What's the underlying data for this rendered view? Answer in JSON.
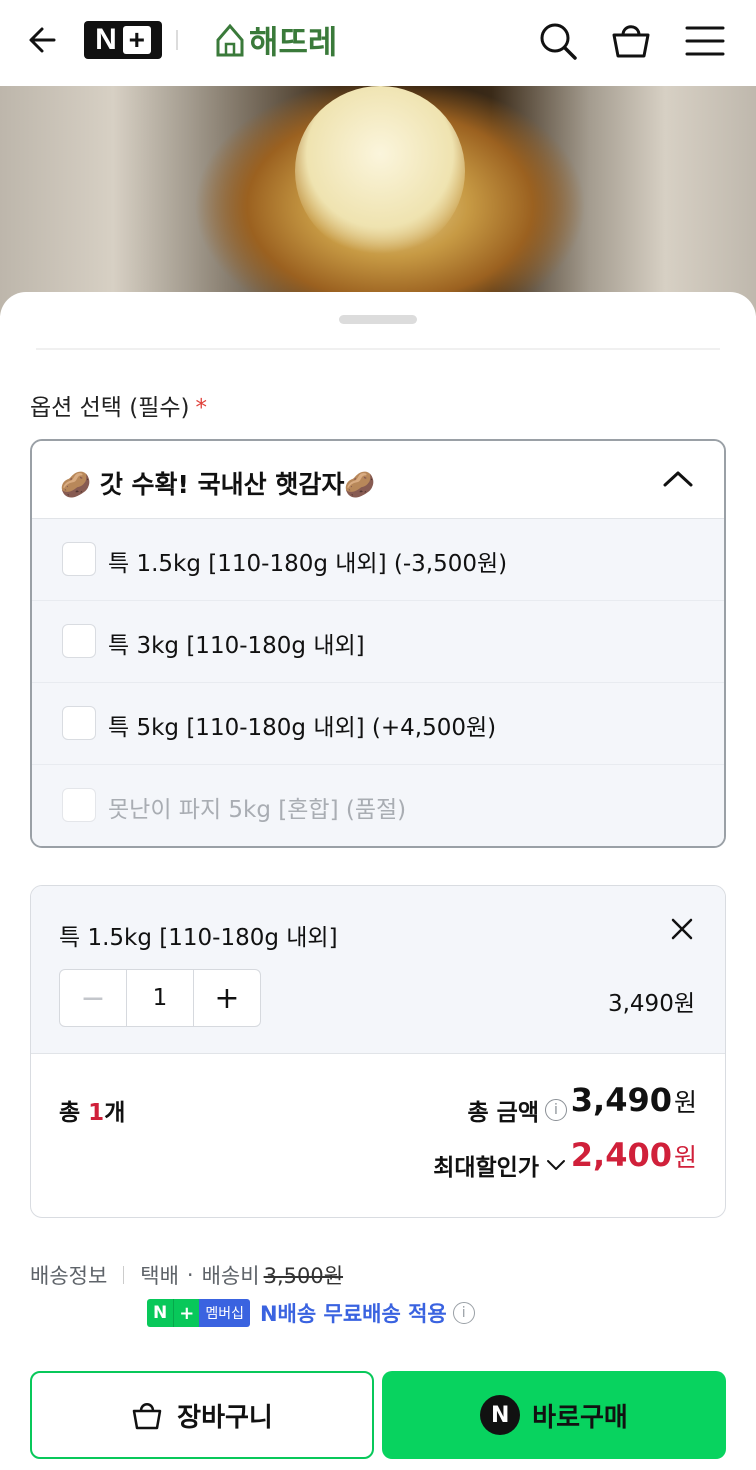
{
  "header": {
    "nplus_letter": "N",
    "nplus_plus": "+",
    "brand_name": "해뜨레",
    "icons": [
      "back-arrow-icon",
      "search-icon",
      "shopping-bag-icon",
      "hamburger-menu-icon"
    ]
  },
  "options": {
    "title": "옵션 선택 (필수)",
    "required_mark": "*",
    "dropdown_label": "🥔 갓 수확! 국내산 햇감자🥔",
    "items": [
      {
        "label": "특 1.5kg [110-180g 내외] (-3,500원)",
        "available": true
      },
      {
        "label": "특 3kg [110-180g 내외]",
        "available": true
      },
      {
        "label": "특 5kg [110-180g 내외] (+4,500원)",
        "available": true
      },
      {
        "label": "못난이 파지 5kg [혼합] (품절)",
        "available": false
      }
    ]
  },
  "selected": {
    "name": "특 1.5kg [110-180g 내외]",
    "quantity": "1",
    "price": "3,490원",
    "minus": "−",
    "plus": "+"
  },
  "summary": {
    "total_prefix": "총 ",
    "total_count": "1",
    "total_suffix": "개",
    "total_amount_label": "총 금액",
    "total_amount": "3,490",
    "won": "원",
    "max_discount_label": "최대할인가",
    "max_discount_amount": "2,400"
  },
  "shipping": {
    "label": "배송정보",
    "method": "택배",
    "dot": "·",
    "fee_label": "배송비",
    "fee": "3,500원",
    "badge_n": "N",
    "badge_plus": "+",
    "badge_text": "멤버십",
    "free_text": "N배송 무료배송 적용"
  },
  "actions": {
    "cart_label": "장바구니",
    "buy_label": "바로구매",
    "buy_icon_letter": "N"
  },
  "colors": {
    "naver_green": "#08d35f",
    "price_red": "#d0203a",
    "membership_blue": "#3a63e0",
    "brand_green": "#3a7a3a"
  }
}
